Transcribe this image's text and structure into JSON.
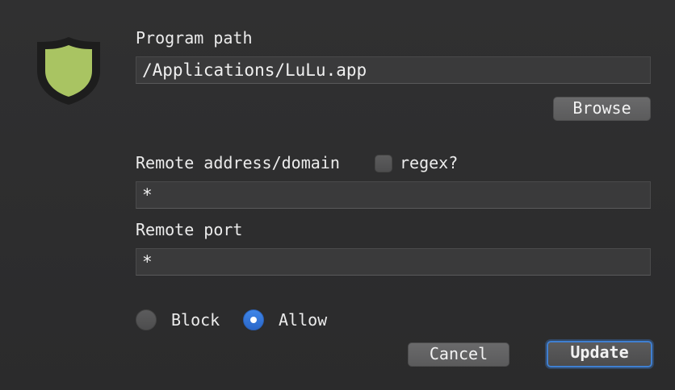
{
  "icons": {
    "logo": "shield-icon",
    "shield_fill": "#a9c462",
    "shield_border": "#1d1d1d"
  },
  "program": {
    "label": "Program path",
    "value": "/Applications/LuLu.app",
    "browse_label": "Browse"
  },
  "remote_address": {
    "label": "Remote address/domain",
    "regex_label": "regex?",
    "regex_checked": false,
    "value": "*"
  },
  "remote_port": {
    "label": "Remote port",
    "value": "*"
  },
  "action": {
    "block_label": "Block",
    "allow_label": "Allow",
    "selected": "Allow"
  },
  "buttons": {
    "cancel_label": "Cancel",
    "update_label": "Update"
  },
  "colors": {
    "accent": "#3f7fd1",
    "background": "#2d2d2e"
  }
}
